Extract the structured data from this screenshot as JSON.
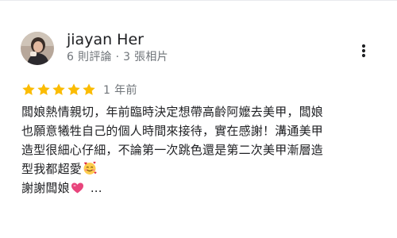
{
  "review": {
    "author_name": "jiayan Her",
    "author_meta": "6 則評論 · 3 張相片",
    "rating": 5,
    "rating_max": 5,
    "star_color": "#fbbc04",
    "time_ago": "1 年前",
    "lines": [
      "闆娘熱情親切，年前臨時決定想帶高齡阿嬤去美甲，闆娘",
      "也願意犧牲自己的個人時間來接待，實在感謝！溝通美甲",
      "造型很細心仔細，不論第一次跳色還是第二次美甲漸層造",
      "型我都超愛"
    ],
    "last_line": "謝謝闆娘",
    "more_text": "...",
    "icons": {
      "menu": "more-vert-icon",
      "star": "star-icon",
      "emoji_love": "smiling-face-with-hearts-emoji",
      "emoji_heart": "pink-heart-emoji"
    }
  }
}
